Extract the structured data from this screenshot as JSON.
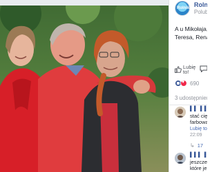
{
  "page": {
    "name": "Rolni",
    "subtitle": "Polub",
    "avatar_text": "Rolnik"
  },
  "post": {
    "text_lines": [
      "A u Mikołaja, w",
      "Teresa, Renat"
    ]
  },
  "actions": {
    "like_label": "Lubię to!",
    "like_icon": "thumbs-up-icon",
    "comment_icon": "comment-icon"
  },
  "reactions": {
    "icons": [
      "like-reaction-icon",
      "love-reaction-icon"
    ],
    "count": "690"
  },
  "shares": {
    "label": "3 udostępnień"
  },
  "comments": [
    {
      "name": "▌▌ ▌▌ ▌▌",
      "lines": [
        "stać cię",
        "farbowa"
      ],
      "meta_like": "Lubię to",
      "meta_time": "22:09"
    },
    {
      "name": "▌▌▌ ▌▌ ▌",
      "lines": [
        "jeszcze",
        "które je"
      ]
    }
  ],
  "replies": {
    "count": "17"
  },
  "colors": {
    "link": "#385898",
    "text": "#1d2129",
    "muted": "#90949c",
    "like_blue": "#3b5998",
    "love_red": "#f0284a"
  }
}
